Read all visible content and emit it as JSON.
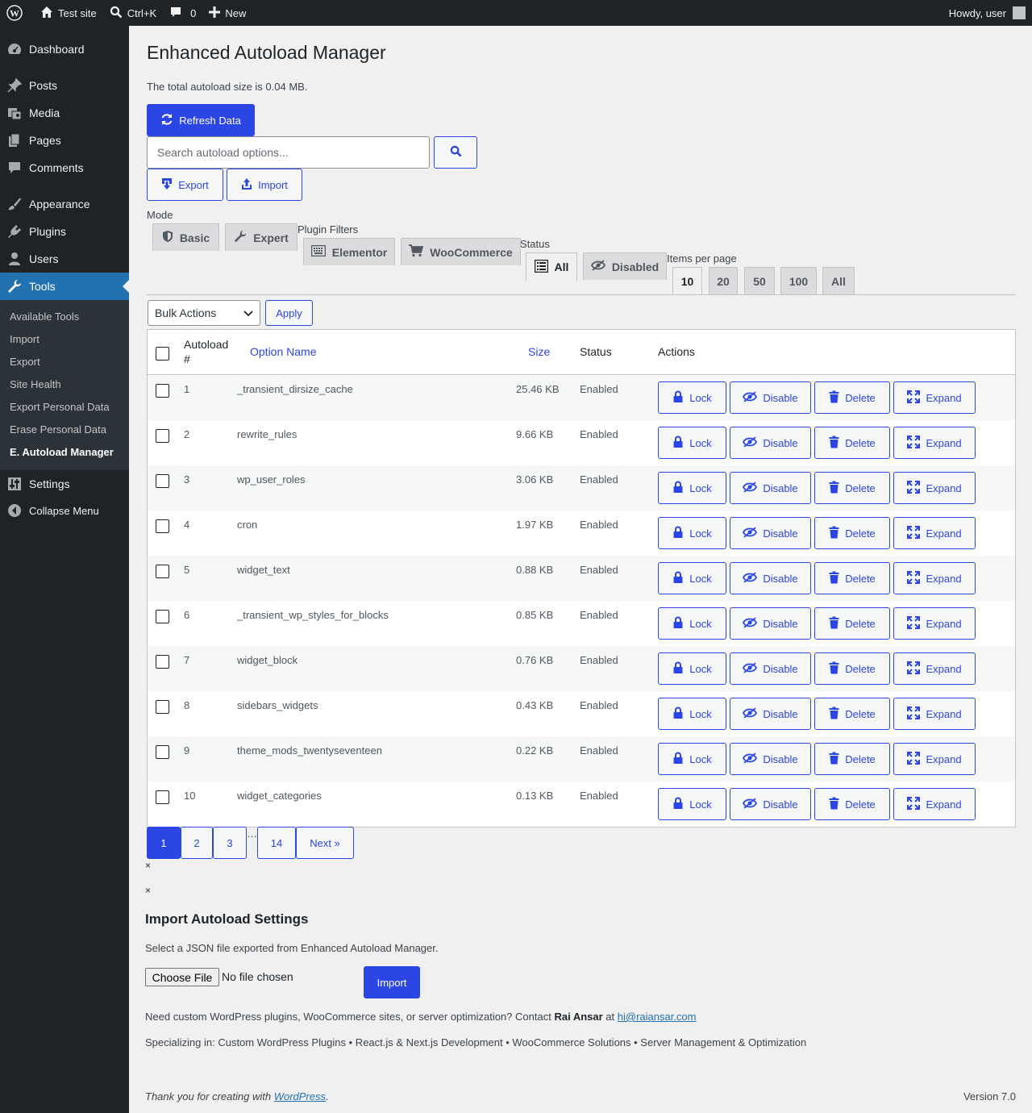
{
  "adminbar": {
    "site_name": "Test site",
    "search_shortcut": "Ctrl+K",
    "comments_count": "0",
    "new_label": "New",
    "howdy": "Howdy, user"
  },
  "sidebar": {
    "items": [
      {
        "label": "Dashboard",
        "icon": "dashboard-icon"
      },
      {
        "label": "Posts",
        "icon": "pin-icon"
      },
      {
        "label": "Media",
        "icon": "media-icon"
      },
      {
        "label": "Pages",
        "icon": "pages-icon"
      },
      {
        "label": "Comments",
        "icon": "comment-icon"
      },
      {
        "label": "Appearance",
        "icon": "brush-icon"
      },
      {
        "label": "Plugins",
        "icon": "plugin-icon"
      },
      {
        "label": "Users",
        "icon": "user-icon"
      },
      {
        "label": "Tools",
        "icon": "wrench-icon"
      }
    ],
    "submenu": [
      "Available Tools",
      "Import",
      "Export",
      "Site Health",
      "Export Personal Data",
      "Erase Personal Data",
      "E. Autoload Manager"
    ],
    "settings": "Settings",
    "collapse": "Collapse Menu"
  },
  "page": {
    "title": "Enhanced Autoload Manager",
    "total": "The total autoload size is 0.04 MB.",
    "refresh_label": "Refresh Data",
    "search_placeholder": "Search autoload options...",
    "export_label": "Export",
    "import_label": "Import"
  },
  "filters": {
    "mode_label": "Mode",
    "mode_tabs": [
      "Basic",
      "Expert"
    ],
    "plugin_label": "Plugin Filters",
    "plugin_tabs": [
      "Elementor",
      "WooCommerce"
    ],
    "status_label": "Status",
    "status_tabs": [
      "All",
      "Disabled"
    ],
    "perpage_label": "Items per page",
    "perpage_tabs": [
      "10",
      "20",
      "50",
      "100",
      "All"
    ]
  },
  "bulk": {
    "selected": "Bulk Actions",
    "apply": "Apply"
  },
  "table": {
    "headers": {
      "num": "Autoload #",
      "name": "Option Name",
      "size": "Size",
      "status": "Status",
      "actions": "Actions"
    },
    "action_labels": {
      "lock": "Lock",
      "disable": "Disable",
      "delete": "Delete",
      "expand": "Expand"
    },
    "rows": [
      {
        "num": "1",
        "name": "_transient_dirsize_cache",
        "size": "25.46 KB",
        "status": "Enabled"
      },
      {
        "num": "2",
        "name": "rewrite_rules",
        "size": "9.66 KB",
        "status": "Enabled"
      },
      {
        "num": "3",
        "name": "wp_user_roles",
        "size": "3.06 KB",
        "status": "Enabled"
      },
      {
        "num": "4",
        "name": "cron",
        "size": "1.97 KB",
        "status": "Enabled"
      },
      {
        "num": "5",
        "name": "widget_text",
        "size": "0.88 KB",
        "status": "Enabled"
      },
      {
        "num": "6",
        "name": "_transient_wp_styles_for_blocks",
        "size": "0.85 KB",
        "status": "Enabled"
      },
      {
        "num": "7",
        "name": "widget_block",
        "size": "0.76 KB",
        "status": "Enabled"
      },
      {
        "num": "8",
        "name": "sidebars_widgets",
        "size": "0.43 KB",
        "status": "Enabled"
      },
      {
        "num": "9",
        "name": "theme_mods_twentyseventeen",
        "size": "0.22 KB",
        "status": "Enabled"
      },
      {
        "num": "10",
        "name": "widget_categories",
        "size": "0.13 KB",
        "status": "Enabled"
      }
    ]
  },
  "pagination": {
    "pages": [
      "1",
      "2",
      "3"
    ],
    "ellipsis": "…",
    "last": "14",
    "next": "Next »"
  },
  "close_symbol": "×",
  "import_section": {
    "title": "Import Autoload Settings",
    "desc": "Select a JSON file exported from Enhanced Autoload Manager.",
    "choose_file": "Choose File",
    "no_file": "No file chosen",
    "submit": "Import"
  },
  "contact": {
    "prefix": "Need custom WordPress plugins, WooCommerce sites, or server optimization? Contact ",
    "name": "Rai Ansar",
    "at": " at ",
    "email": "hi@raiansar.com"
  },
  "specializing": "Specializing in: Custom WordPress Plugins • React.js & Next.js Development • WooCommerce Solutions • Server Management & Optimization",
  "footer": {
    "thanks_prefix": "Thank you for creating with ",
    "wordpress": "WordPress",
    "thanks_suffix": ".",
    "version": "Version 7.0"
  },
  "colors": {
    "accent": "#2c45e5",
    "admin_dark": "#1d2327",
    "menu_current": "#2271b1"
  }
}
